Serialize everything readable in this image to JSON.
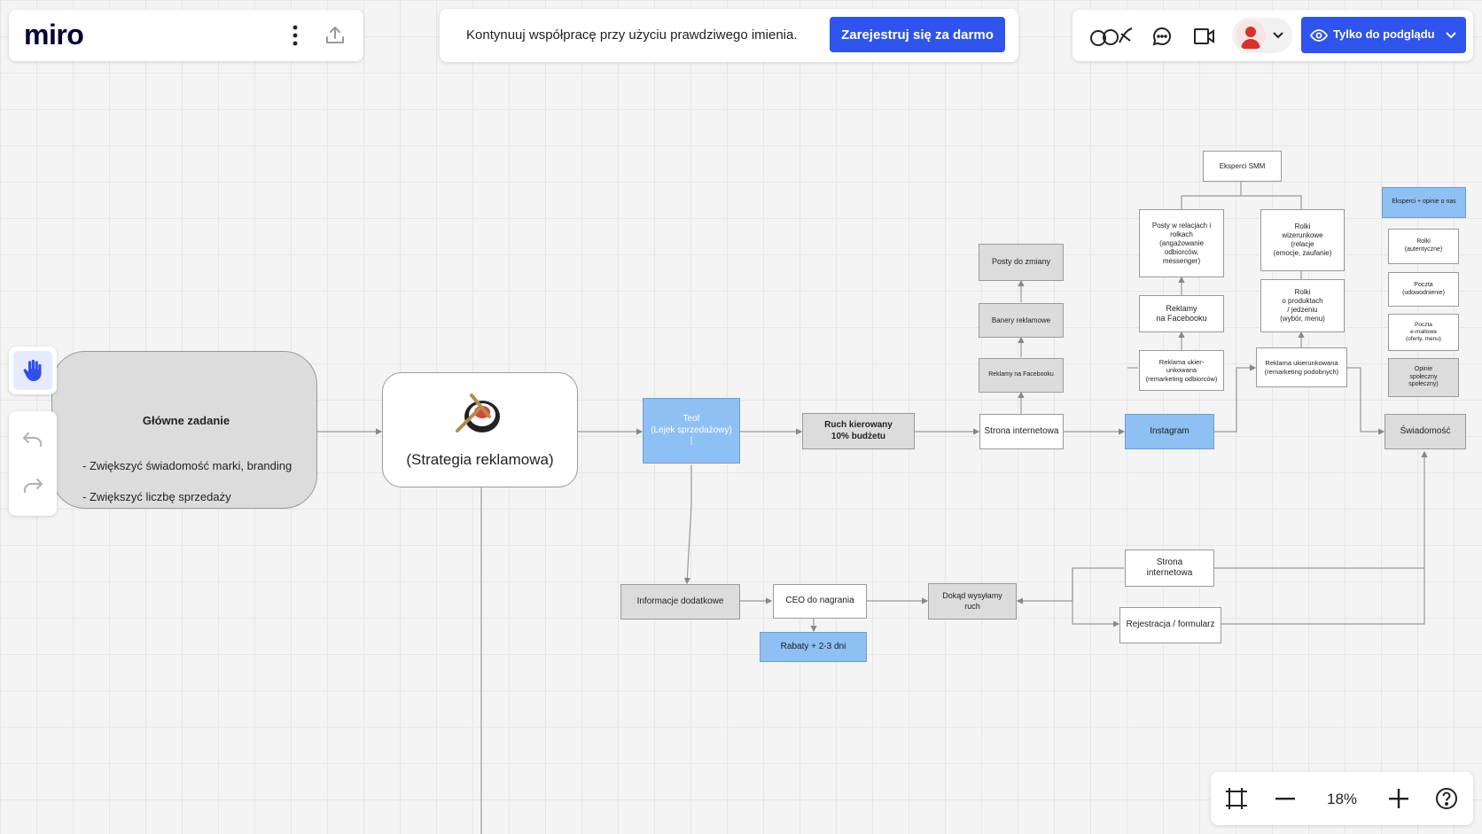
{
  "topbar": {
    "logo_text": "miro",
    "banner_text": "Kontynuuj współpracę przy użyciu prawdziwego imienia.",
    "signup_label": "Zarejestruj się za darmo",
    "view_only_label": "Tylko do podglądu",
    "accent_color": "#2f54eb"
  },
  "toolbar": {
    "tools": [
      "hand-icon",
      "undo-icon",
      "redo-icon"
    ]
  },
  "zoom": {
    "level": "18%"
  },
  "board": {
    "main_task_title": "Główne zadanie",
    "main_task_item1": "- Zwiększyć świadomość marki, branding",
    "main_task_item2": "- Zwiększyć liczbę sprzedaży",
    "strategy_label": "(Strategia reklamowa)",
    "tof": "Teof\n(Lejek sprzedażowy)\n|",
    "ruch": "Ruch kierowany\n10% budżetu",
    "strona1": "Strona internetowa",
    "posty_zmiany": "Posty do zmiany",
    "banery": "Banery reklamowe",
    "reklamy_fb_small": "Reklamy na Facebooku",
    "instagram": "Instagram",
    "eksperci_smm": "Eksperci SMM",
    "posty_relacje": "Posty w relacjach i\nrolkach\n(angażowanie\nodbiorców,\nmessenger)",
    "rolki_wiz": "Rolki\nwizerunkowe\n(relacje\n(emocje, zaufanie)",
    "reklamy_fb": "Reklamy\nna Facebooku",
    "rolki_prod": "Rolki\no produktach\n/ jedzeniu\n(wybór, menu)",
    "reklama_uk1": "Reklama ukier-\nunkowana\n(remarketing odbiorców)",
    "reklama_uk2": "Reklama ukierunkowana\n(remarketing podobnych)",
    "eksperci_opinie": "Eksperci + opinie o nas",
    "rolki_aut": "Rolki\n(autentyczne)",
    "poczta_udow": "Poczta\n(udowodnienie)",
    "poczta_mail": "Poczta\ne-mailowa\n(oferty, menu)",
    "opinie": "Opinie\nspołeczny\nspołeczny)",
    "swiadomosc": "Świadomość",
    "info_dod": "Informacje dodatkowe",
    "ceo": "CEO do nagrania",
    "rabaty": "Rabaty + 2-3 dni",
    "dokad": "Dokąd wysyłamy\nruch",
    "strona2": "Strona\ninternetowa",
    "rejestracja": "Rejestracja / formularz"
  }
}
